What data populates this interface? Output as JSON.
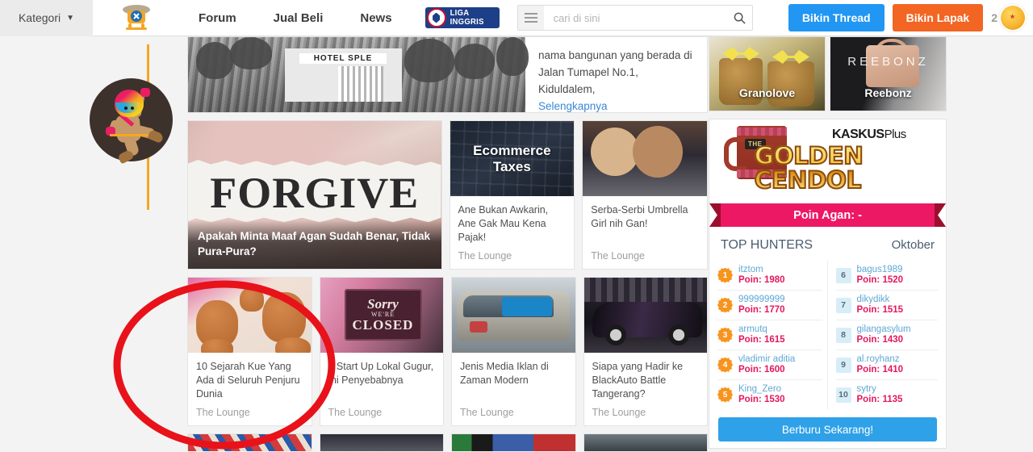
{
  "header": {
    "kategori_label": "Kategori",
    "nav": [
      {
        "label": "Forum"
      },
      {
        "label": "Jual Beli"
      },
      {
        "label": "News"
      }
    ],
    "liga_label": "LIGA INGGRIS",
    "search": {
      "placeholder": "cari di sini",
      "value": ""
    },
    "create_thread_label": "Bikin Thread",
    "create_lapak_label": "Bikin Lapak",
    "notification_count": "2",
    "colors": {
      "thread_blue": "#2196f3",
      "lapak_orange": "#f26522",
      "liga_navy": "#1d3f87"
    }
  },
  "topnews": {
    "text_line1": "nama bangunan yang berada di",
    "text_line2": "Jalan Tumapel No.1, Kiduldalem,",
    "more_label": "Selengkapnya",
    "image_sign": "HOTEL SPLE"
  },
  "ads": [
    {
      "label": "Granolove",
      "watermark": ""
    },
    {
      "label": "Reebonz",
      "watermark": "REEBONZ"
    }
  ],
  "featured": {
    "overlay_title": "Apakah Minta Maaf Agan Sudah Benar, Tidak Pura-Pura?",
    "image_word": "FORGIVE"
  },
  "cards_row1": [
    {
      "thumb_text_line1": "Ecommerce",
      "thumb_text_line2": "Taxes",
      "title": "Ane Bukan Awkarin, Ane Gak Mau Kena Pajak!",
      "category": "The Lounge"
    },
    {
      "thumb_text_line1": "",
      "thumb_text_line2": "",
      "title": "Serba-Serbi Umbrella Girl nih Gan!",
      "category": "The Lounge"
    }
  ],
  "cards_row2": [
    {
      "title": "10 Sejarah Kue Yang Ada di Seluruh Penjuru Dunia",
      "category": "The Lounge"
    },
    {
      "title": "7 Start Up Lokal Gugur, Ini Penyebabnya",
      "category": "The Lounge",
      "sign_l1": "Sorry",
      "sign_l2": "WE'RE",
      "sign_l3": "CLOSED"
    },
    {
      "title": "Jenis Media Iklan di Zaman Modern",
      "category": "The Lounge"
    },
    {
      "title": "Siapa yang Hadir ke BlackAuto Battle Tangerang?",
      "category": "The Lounge"
    }
  ],
  "golden_cendol": {
    "brand": "KASKUS",
    "brand_suffix": "Plus",
    "the_label": "THE",
    "title": "GOLDEN CENDOL",
    "points_label": "Poin Agan: -",
    "top_hunters_label": "TOP HUNTERS",
    "month": "Oktober",
    "hunters_left": [
      {
        "rank": "1",
        "name": "itztom",
        "points": "Poin: 1980"
      },
      {
        "rank": "2",
        "name": "999999999",
        "points": "Poin: 1770"
      },
      {
        "rank": "3",
        "name": "armutq",
        "points": "Poin: 1615"
      },
      {
        "rank": "4",
        "name": "vladimir aditia",
        "points": "Poin: 1600"
      },
      {
        "rank": "5",
        "name": "King_Zero",
        "points": "Poin: 1530"
      }
    ],
    "hunters_right": [
      {
        "rank": "6",
        "name": "bagus1989",
        "points": "Poin: 1520"
      },
      {
        "rank": "7",
        "name": "dikydikk",
        "points": "Poin: 1515"
      },
      {
        "rank": "8",
        "name": "gilangasylum",
        "points": "Poin: 1430"
      },
      {
        "rank": "9",
        "name": "al.royhanz",
        "points": "Poin: 1410"
      },
      {
        "rank": "10",
        "name": "sytry",
        "points": "Poin: 1135"
      }
    ],
    "cta_label": "Berburu Sekarang!",
    "colors": {
      "ribbon": "#ec1864",
      "cta": "#2fa1e8",
      "points": "#e4175c",
      "name": "#5fa8d3"
    }
  },
  "annotation": {
    "shape": "ellipse",
    "color": "#e8121a",
    "stroke_width": 9
  }
}
